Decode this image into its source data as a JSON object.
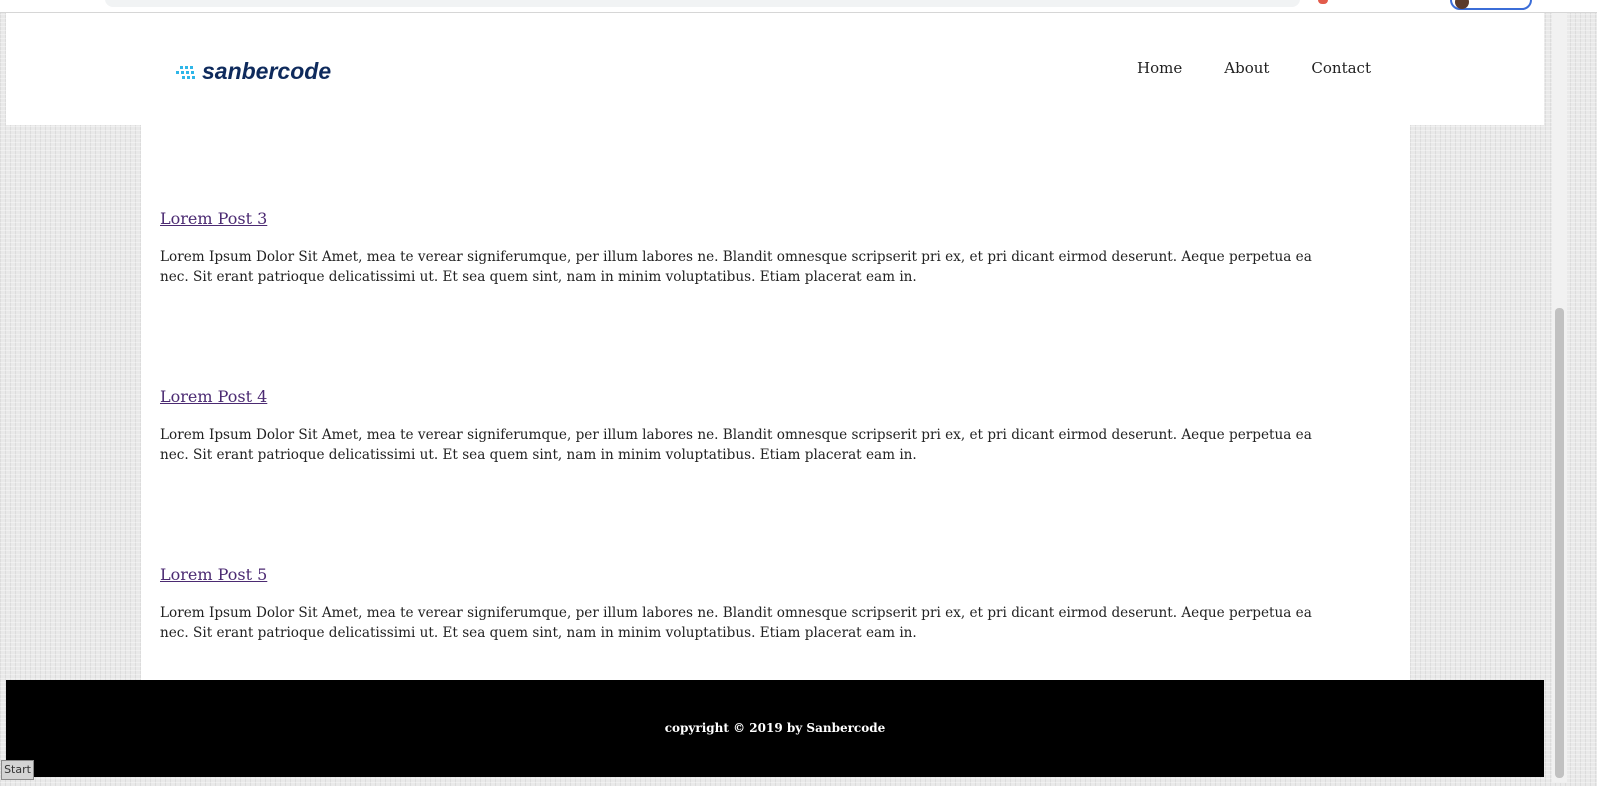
{
  "logo": {
    "text": "sanbercode",
    "brand_color": "#0e2a5c",
    "accent_color": "#2fb6e8"
  },
  "nav": {
    "items": [
      {
        "label": "Home"
      },
      {
        "label": "About"
      },
      {
        "label": "Contact"
      }
    ]
  },
  "posts": [
    {
      "title": "Lorem Post 3",
      "body": "Lorem Ipsum Dolor Sit Amet, mea te verear signiferumque, per illum labores ne. Blandit omnesque scripserit pri ex, et pri dicant eirmod deserunt. Aeque perpetua ea nec. Sit erant patrioque delicatissimi ut. Et sea quem sint, nam in minim voluptatibus. Etiam placerat eam in."
    },
    {
      "title": "Lorem Post 4",
      "body": "Lorem Ipsum Dolor Sit Amet, mea te verear signiferumque, per illum labores ne. Blandit omnesque scripserit pri ex, et pri dicant eirmod deserunt. Aeque perpetua ea nec. Sit erant patrioque delicatissimi ut. Et sea quem sint, nam in minim voluptatibus. Etiam placerat eam in."
    },
    {
      "title": "Lorem Post 5",
      "body": "Lorem Ipsum Dolor Sit Amet, mea te verear signiferumque, per illum labores ne. Blandit omnesque scripserit pri ex, et pri dicant eirmod deserunt. Aeque perpetua ea nec. Sit erant patrioque delicatissimi ut. Et sea quem sint, nam in minim voluptatibus. Etiam placerat eam in."
    }
  ],
  "footer": {
    "text": "copyright © 2019 by Sanbercode"
  },
  "taskbar": {
    "start_label": "Start"
  },
  "colors": {
    "link": "#4b2a72",
    "footer_bg": "#000000"
  }
}
